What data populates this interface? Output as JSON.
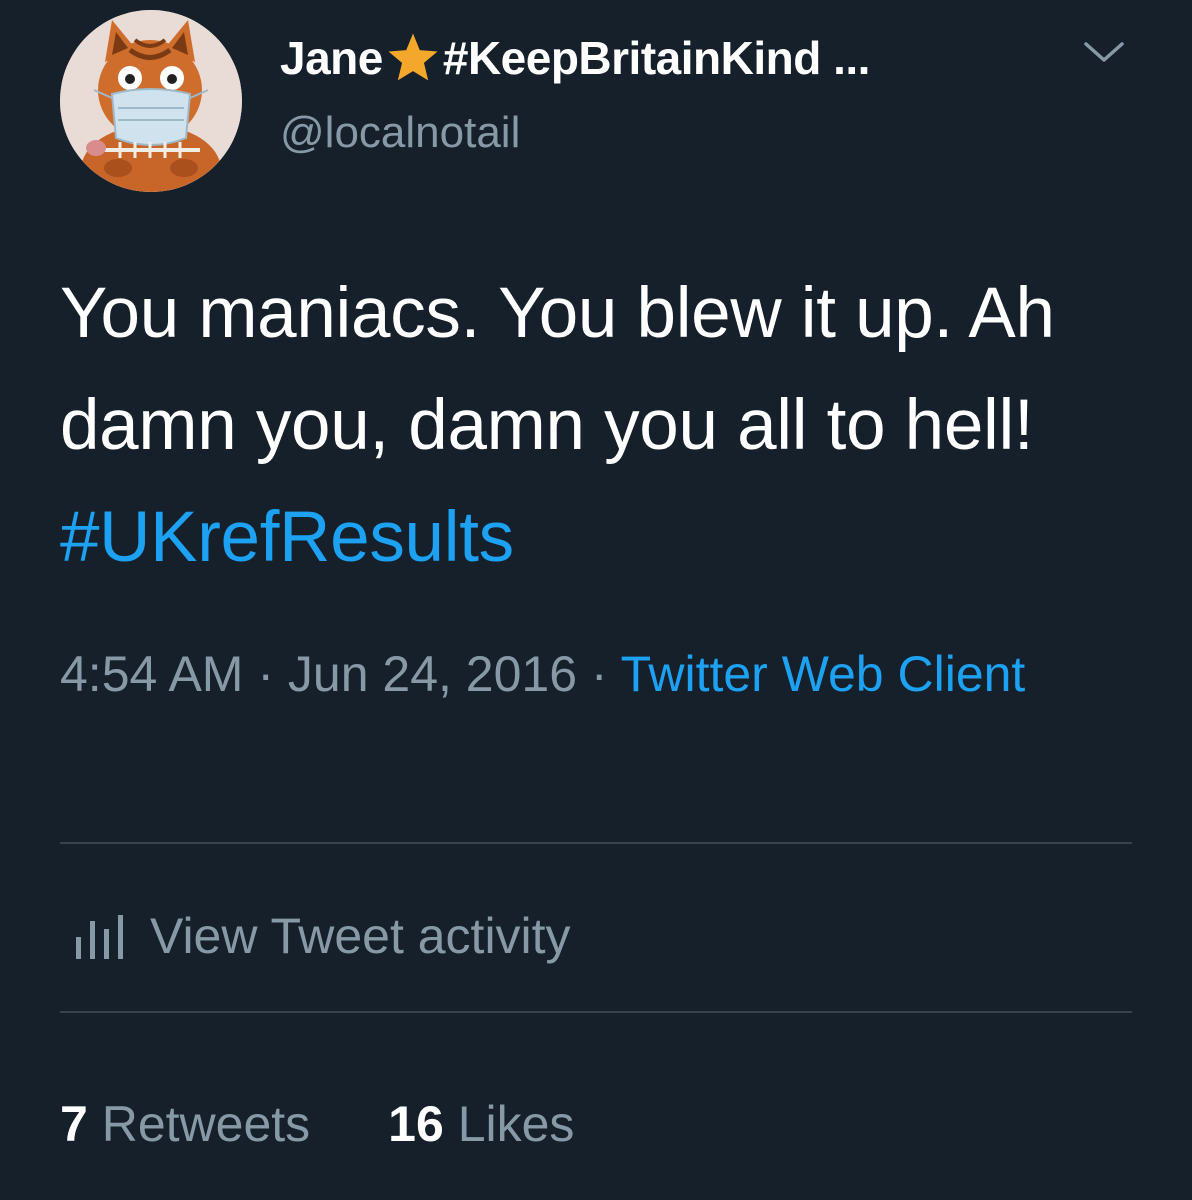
{
  "colors": {
    "background": "#15202b",
    "text_primary": "#ffffff",
    "text_secondary": "#8899a6",
    "link": "#1da1f2",
    "divider": "#38444d",
    "star": "#f4a82b"
  },
  "author": {
    "name": "Jane",
    "name_suffix": "#KeepBritainKind ...",
    "emoji_icon": "star-icon",
    "handle": "@localnotail",
    "avatar_icon": "cat-in-face-mask-avatar"
  },
  "tweet": {
    "text_before_hashtag": "You maniacs. You blew it up. Ah damn you, damn you all to hell! ",
    "hashtag": "#UKrefResults"
  },
  "meta": {
    "time": "4:54 AM",
    "separator": " · ",
    "date": "Jun 24, 2016",
    "source": "Twitter Web Client"
  },
  "activity": {
    "icon": "bar-chart-icon",
    "label": "View Tweet activity"
  },
  "stats": {
    "retweets_count": "7",
    "retweets_label": "Retweets",
    "likes_count": "16",
    "likes_label": "Likes"
  },
  "menu_icon": "chevron-down-icon"
}
